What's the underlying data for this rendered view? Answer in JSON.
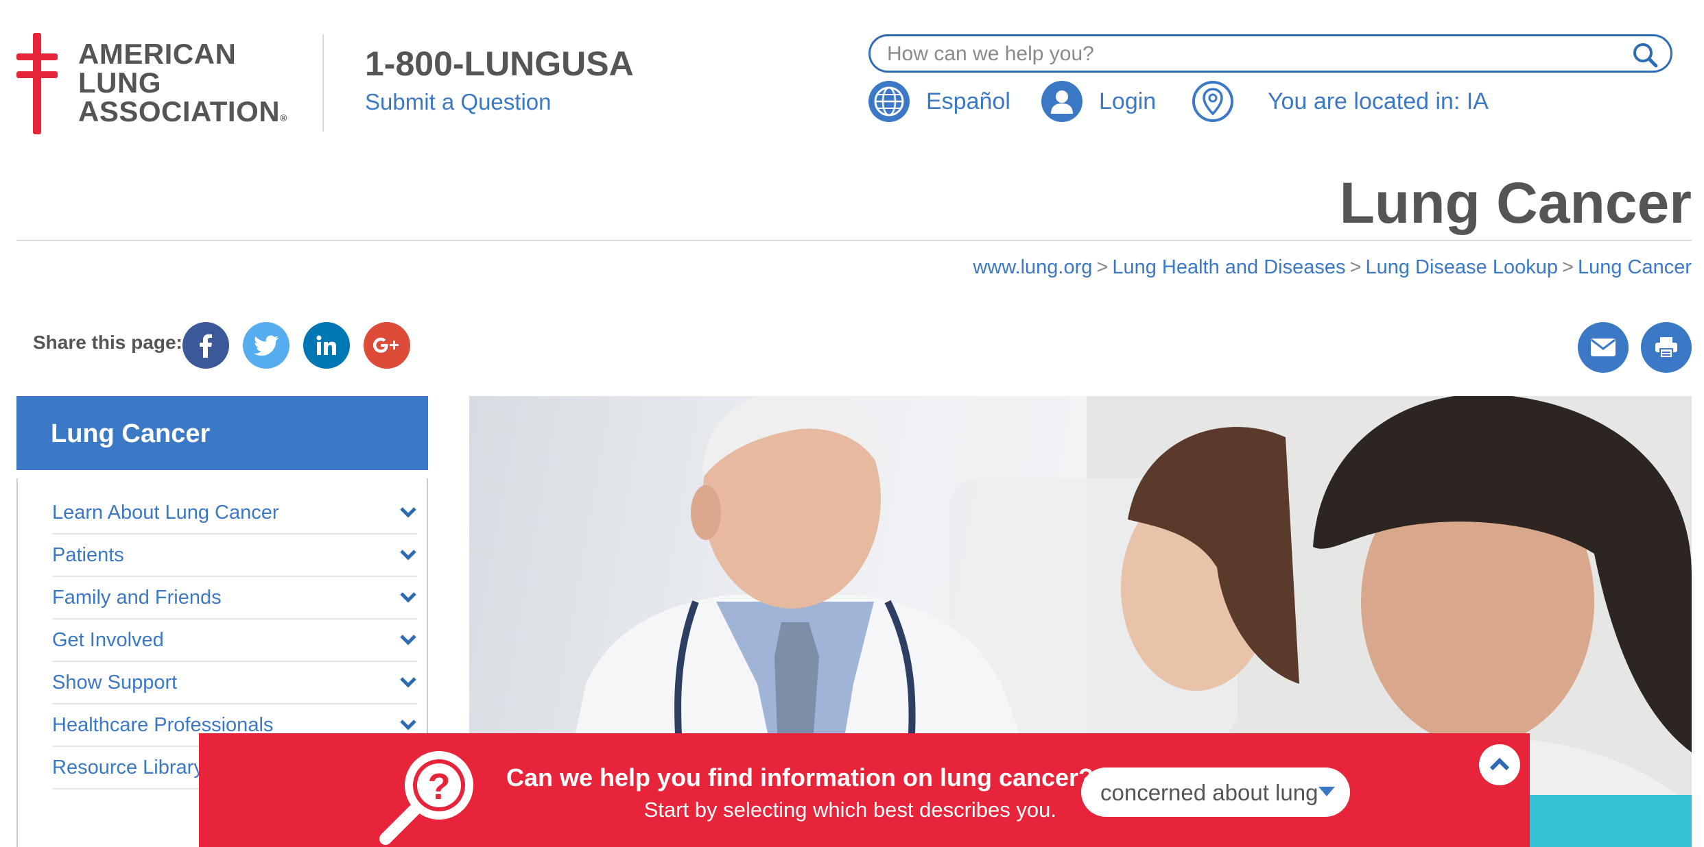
{
  "brand": {
    "logo_lines": [
      "AMERICAN",
      "LUNG",
      "ASSOCIATION"
    ],
    "logo_registered": "®",
    "phone": "1-800-LUNGUSA",
    "submit_link": "Submit a Question",
    "brand_red": "#e8243a",
    "brand_blue": "#3b78c6"
  },
  "search": {
    "placeholder": "How can we help you?",
    "value": ""
  },
  "utility_nav": {
    "language": "Español",
    "login": "Login",
    "location": "You are located in: IA"
  },
  "page": {
    "title": "Lung Cancer"
  },
  "breadcrumb": {
    "separator": ">",
    "items": [
      "www.lung.org",
      "Lung Health and Diseases",
      "Lung Disease Lookup",
      "Lung Cancer"
    ]
  },
  "share": {
    "label": "Share this page:",
    "networks": [
      {
        "name": "facebook-icon",
        "color": "#3b5998"
      },
      {
        "name": "twitter-icon",
        "color": "#55acee"
      },
      {
        "name": "linkedin-icon",
        "color": "#0077b5"
      },
      {
        "name": "google-plus-icon",
        "color": "#dd4b39"
      }
    ]
  },
  "sidebar": {
    "heading": "Lung Cancer",
    "items": [
      {
        "label": "Learn About Lung Cancer"
      },
      {
        "label": "Patients"
      },
      {
        "label": "Family and Friends"
      },
      {
        "label": "Get Involved"
      },
      {
        "label": "Show Support"
      },
      {
        "label": "Healthcare Professionals"
      },
      {
        "label": "Resource Library"
      }
    ]
  },
  "help_bar": {
    "title": "Can we help you find information on lung cancer?",
    "subtitle": "Start by selecting which best describes you.",
    "select_value": "concerned about lung"
  }
}
